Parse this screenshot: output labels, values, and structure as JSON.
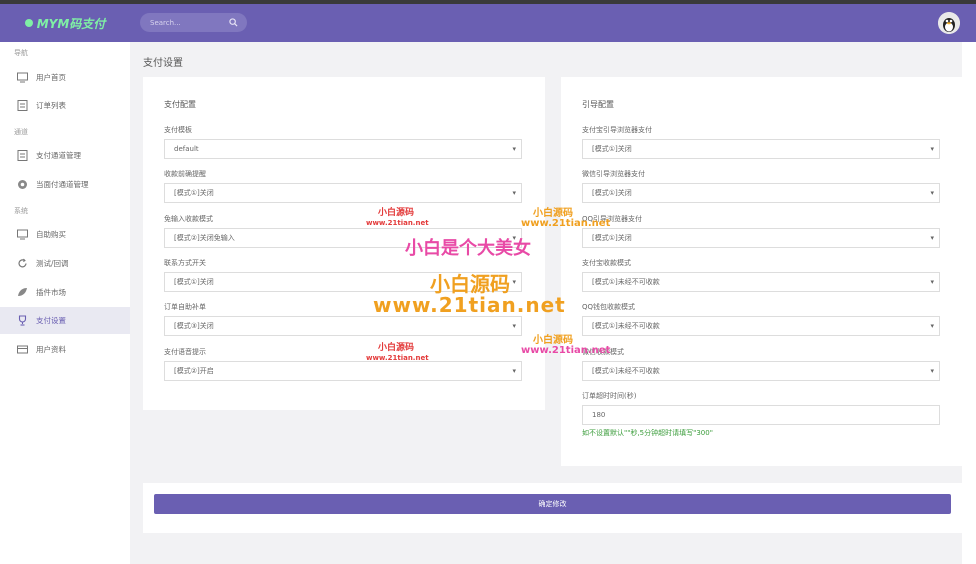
{
  "header": {
    "logo_text": "MYM码支付",
    "search_placeholder": "Search..."
  },
  "sidebar": {
    "sections": [
      {
        "label": "导航"
      },
      {
        "label": "通道"
      },
      {
        "label": "系统"
      }
    ],
    "items": [
      {
        "label": "用户首页",
        "icon": "monitor-icon"
      },
      {
        "label": "订单列表",
        "icon": "list-icon"
      },
      {
        "label": "支付通道管理",
        "icon": "list-icon"
      },
      {
        "label": "当面付通道管理",
        "icon": "gear-icon"
      },
      {
        "label": "自助购买",
        "icon": "monitor-icon"
      },
      {
        "label": "测试/回调",
        "icon": "refresh-icon"
      },
      {
        "label": "插件市场",
        "icon": "leaf-icon"
      },
      {
        "label": "支付设置",
        "icon": "trophy-icon"
      },
      {
        "label": "用户资料",
        "icon": "card-icon"
      }
    ]
  },
  "breadcrumb": "支付设置",
  "left_card": {
    "title": "支付配置",
    "fields": [
      {
        "label": "支付模板",
        "value": "default"
      },
      {
        "label": "收款前确提醒",
        "value": "[模式①]关闭"
      },
      {
        "label": "免输入收款模式",
        "value": "[模式②]关闭免输入"
      },
      {
        "label": "联系方式开关",
        "value": "[模式①]关闭"
      },
      {
        "label": "订单自助补单",
        "value": "[模式③]关闭"
      },
      {
        "label": "支付语音提示",
        "value": "[模式②]开启"
      }
    ]
  },
  "right_card": {
    "title": "引导配置",
    "fields": [
      {
        "label": "支付宝引导浏览器支付",
        "value": "[模式①]关闭"
      },
      {
        "label": "微信引导浏览器支付",
        "value": "[模式①]关闭"
      },
      {
        "label": "QQ引导浏览器支付",
        "value": "[模式①]关闭"
      },
      {
        "label": "支付宝收款模式",
        "value": "[模式①]未经不可收款"
      },
      {
        "label": "QQ钱包收款模式",
        "value": "[模式①]未经不可收款"
      },
      {
        "label": "微信收款模式",
        "value": "[模式①]未经不可收款"
      }
    ],
    "timeout_label": "订单超时时间(秒)",
    "timeout_value": "180",
    "timeout_hint": "如不设置默认\"\"秒,5分钟超时请填写\"300\""
  },
  "save_button": "确定修改",
  "watermarks": {
    "a": "小白源码",
    "b": "www.21tian.net",
    "c": "小白是个大美女",
    "d": "小白源码",
    "e": "www.21tian.net"
  },
  "colors": {
    "header": "#6a5fb2",
    "accent": "#6a5fb2",
    "hint": "#3a9c3a"
  }
}
